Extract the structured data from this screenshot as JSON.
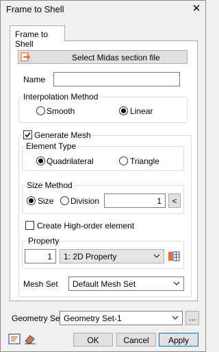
{
  "window": {
    "title": "Frame to Shell",
    "close_glyph": "✕"
  },
  "tab": {
    "label": "Frame to Shell"
  },
  "select_file_button": {
    "label": "Select Midas section file",
    "icon": "arrow-file-icon"
  },
  "name": {
    "label": "Name",
    "value": ""
  },
  "interpolation": {
    "legend": "Interpolation Method",
    "options": [
      {
        "label": "Smooth",
        "selected": false
      },
      {
        "label": "Linear",
        "selected": true
      }
    ]
  },
  "generate_mesh": {
    "label": "Generate Mesh",
    "checked": true
  },
  "element_type": {
    "legend": "Element Type",
    "options": [
      {
        "label": "Quadrilateral",
        "selected": true
      },
      {
        "label": "Triangle",
        "selected": false
      }
    ]
  },
  "size_method": {
    "legend": "Size Method",
    "options": [
      {
        "label": "Size",
        "selected": true
      },
      {
        "label": "Division",
        "selected": false
      }
    ],
    "value": "1",
    "pick_label": "<"
  },
  "high_order": {
    "label": "Create High-order element",
    "checked": false
  },
  "property": {
    "legend": "Property",
    "number": "1",
    "selected": "1: 2D Property",
    "icon": "property-table-icon"
  },
  "mesh_set": {
    "label": "Mesh Set",
    "selected": "Default Mesh Set"
  },
  "geometry_set": {
    "label": "Geometry Set",
    "selected": "Geometry Set-1",
    "more_label": "..."
  },
  "footer": {
    "ok": "OK",
    "cancel": "Cancel",
    "apply": "Apply",
    "icons": [
      "report-icon",
      "eraser-icon"
    ]
  },
  "colors": {
    "accent_blue": "#0078d7",
    "orange_icon": "#e8702a"
  }
}
